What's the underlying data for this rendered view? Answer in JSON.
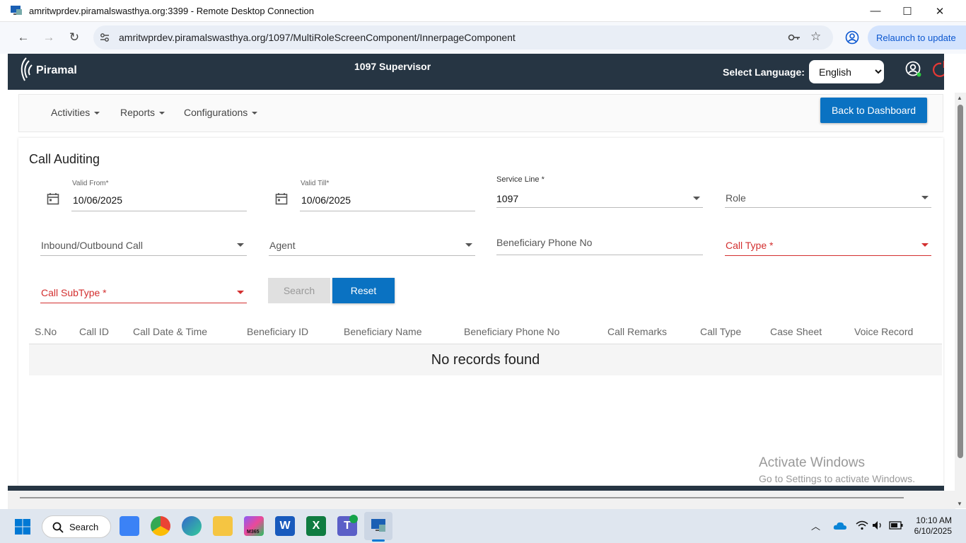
{
  "rdp": {
    "title": "amritwprdev.piramalswasthya.org:3399 - Remote Desktop Connection",
    "minimize": "—",
    "maximize": "☐",
    "close": "✕"
  },
  "browser": {
    "url": "amritwprdev.piramalswasthya.org/1097/MultiRoleScreenComponent/InnerpageComponent",
    "relaunch_label": "Relaunch to update"
  },
  "header": {
    "logo_text": "Piramal",
    "app_title": "1097 Supervisor",
    "language_label": "Select Language:",
    "language_selected": "English"
  },
  "menu": {
    "items": [
      {
        "label": "Activities"
      },
      {
        "label": "Reports"
      },
      {
        "label": "Configurations"
      }
    ],
    "back_button": "Back to Dashboard"
  },
  "form": {
    "title": "Call Auditing",
    "valid_from_label": "Valid From*",
    "valid_from_value": "10/06/2025",
    "valid_till_label": "Valid Till*",
    "valid_till_value": "10/06/2025",
    "service_line_label": "Service Line *",
    "service_line_value": "1097",
    "role_placeholder": "Role",
    "inbound_outbound_placeholder": "Inbound/Outbound Call",
    "agent_placeholder": "Agent",
    "beneficiary_phone_placeholder": "Beneficiary Phone No",
    "call_type_placeholder": "Call Type *",
    "call_subtype_placeholder": "Call SubType *",
    "search_button": "Search",
    "reset_button": "Reset"
  },
  "table": {
    "columns": [
      "S.No",
      "Call ID",
      "Call Date & Time",
      "Beneficiary ID",
      "Beneficiary Name",
      "Beneficiary Phone No",
      "Call Remarks",
      "Call Type",
      "Case Sheet",
      "Voice Record"
    ],
    "empty_message": "No records found"
  },
  "watermark": {
    "line1": "Activate Windows",
    "line2": "Go to Settings to activate Windows."
  },
  "taskbar": {
    "search_label": "Search",
    "time": "10:10 AM",
    "date": "6/10/2025",
    "m365_label": "M365"
  },
  "colors": {
    "header_bg": "#263543",
    "primary_button": "#0a72c2",
    "required_red": "#d32f2f"
  }
}
